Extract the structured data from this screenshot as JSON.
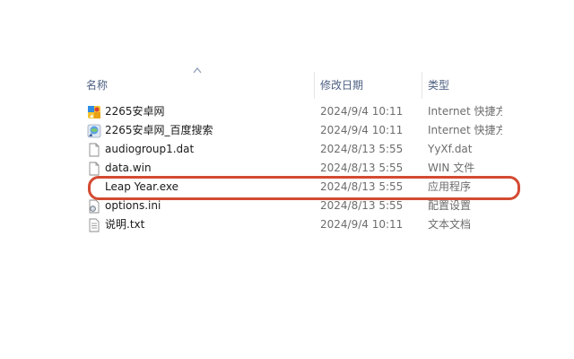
{
  "header": {
    "name_label": "名称",
    "date_label": "修改日期",
    "type_label": "类型"
  },
  "files": [
    {
      "name": "2265安卓网",
      "date": "2024/9/4 10:11",
      "type": "Internet 快捷方式",
      "icon": "internet-shortcut-icon"
    },
    {
      "name": "2265安卓网_百度搜索",
      "date": "2024/9/4 10:11",
      "type": "Internet 快捷方式",
      "icon": "internet-shortcut-icon"
    },
    {
      "name": "audiogroup1.dat",
      "date": "2024/8/13 5:55",
      "type": "YyXf.dat",
      "icon": "blank-file-icon"
    },
    {
      "name": "data.win",
      "date": "2024/8/13 5:55",
      "type": "WIN 文件",
      "icon": "blank-file-icon"
    },
    {
      "name": "Leap Year.exe",
      "date": "2024/8/13 5:55",
      "type": "应用程序",
      "icon": "application-icon"
    },
    {
      "name": "options.ini",
      "date": "2024/8/13 5:55",
      "type": "配置设置",
      "icon": "config-settings-icon"
    },
    {
      "name": "说明.txt",
      "date": "2024/9/4 10:11",
      "type": "文本文档",
      "icon": "text-document-icon"
    }
  ],
  "highlight": {
    "row": 4,
    "color": "#d34a32"
  }
}
